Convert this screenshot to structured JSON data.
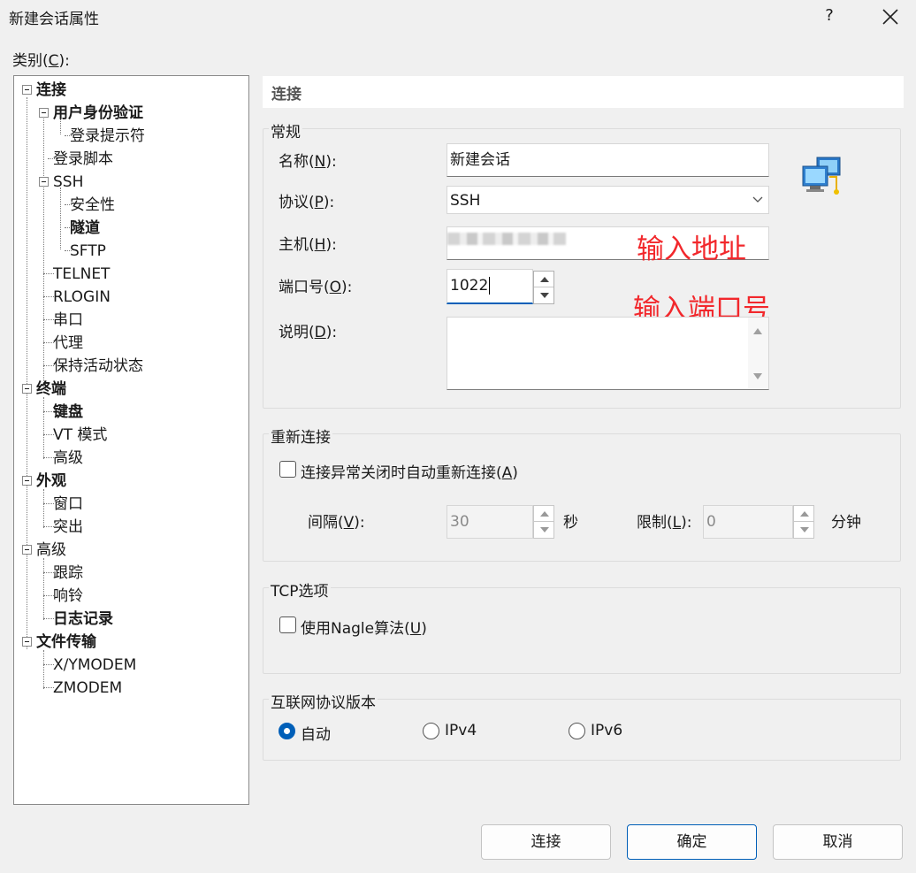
{
  "window": {
    "title": "新建会话属性",
    "help": "?"
  },
  "category": {
    "label": "类别(",
    "key": "C",
    "tail": "):"
  },
  "tree": {
    "connection": "连接",
    "auth": "用户身份验证",
    "login_prompt": "登录提示符",
    "login_script": "登录脚本",
    "ssh": "SSH",
    "security": "安全性",
    "tunnel": "隧道",
    "sftp": "SFTP",
    "telnet": "TELNET",
    "rlogin": "RLOGIN",
    "serial": "串口",
    "proxy": "代理",
    "keepalive": "保持活动状态",
    "terminal": "终端",
    "keyboard": "键盘",
    "vt_mode": "VT 模式",
    "term_advanced": "高级",
    "appearance": "外观",
    "window": "窗口",
    "highlight": "突出",
    "advanced": "高级",
    "trace": "跟踪",
    "bell": "响铃",
    "logging": "日志记录",
    "file_transfer": "文件传输",
    "xymodem": "X/YMODEM",
    "zmodem": "ZMODEM"
  },
  "section_title": "连接",
  "general": {
    "group": "常规",
    "name_label": "名称(",
    "name_key": "N",
    "name_tail": "):",
    "name_value": "新建会话",
    "protocol_label": "协议(",
    "protocol_key": "P",
    "protocol_tail": "):",
    "protocol_value": "SSH",
    "host_label": "主机(",
    "host_key": "H",
    "host_tail": "):",
    "host_value": "",
    "port_label": "端口号(",
    "port_key": "O",
    "port_tail": "):",
    "port_value": "1022",
    "desc_label": "说明(",
    "desc_key": "D",
    "desc_tail": "):",
    "desc_value": ""
  },
  "annotations": {
    "host": "输入地址",
    "port": "输入端口号"
  },
  "reconnect": {
    "group": "重新连接",
    "checkbox_label": "连接异常关闭时自动重新连接(",
    "checkbox_key": "A",
    "checkbox_tail": ")",
    "checked": false,
    "interval_label": "间隔(",
    "interval_key": "V",
    "interval_tail": "):",
    "interval_value": "30",
    "interval_unit": "秒",
    "limit_label": "限制(",
    "limit_key": "L",
    "limit_tail": "):",
    "limit_value": "0",
    "limit_unit": "分钟"
  },
  "tcp": {
    "group": "TCP选项",
    "nagle_label": "使用Nagle算法(",
    "nagle_key": "U",
    "nagle_tail": ")",
    "checked": false
  },
  "ip_version": {
    "group": "互联网协议版本",
    "options": [
      "自动",
      "IPv4",
      "IPv6"
    ],
    "selected": "自动"
  },
  "buttons": {
    "connect": "连接",
    "ok": "确定",
    "cancel": "取消"
  },
  "colors": {
    "accent": "#005fb8",
    "annotation": "#f2282c"
  }
}
